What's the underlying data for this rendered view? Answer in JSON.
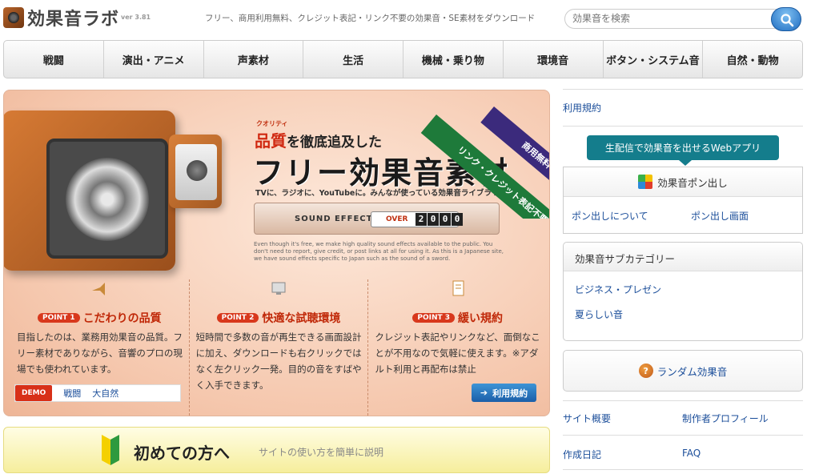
{
  "header": {
    "logo_text": "効果音ラボ",
    "version": "ver 3.81",
    "tagline": "フリー、商用利用無料、クレジット表記・リンク不要の効果音・SE素材をダウンロード",
    "search_placeholder": "効果音を検索"
  },
  "nav": [
    {
      "label": "戦闘"
    },
    {
      "label": "演出・アニメ"
    },
    {
      "label": "声素材"
    },
    {
      "label": "生活"
    },
    {
      "label": "機械・乗り物"
    },
    {
      "label": "環境音"
    },
    {
      "label": "ボタン・システム音"
    },
    {
      "label": "自然・動物"
    }
  ],
  "hero": {
    "ruby": "クオリティ",
    "headline_red": "品質",
    "headline_rest": "を徹底追及した",
    "headline_main": "フリー効果音素材",
    "subcopy": "TVに、ラジオに、YouTubeに。みんなが使っている効果音ライブラリ",
    "se_label": "SOUND EFFECTS",
    "over_label": "OVER",
    "counter_digits": [
      "2",
      "0",
      "0",
      "0"
    ],
    "english_copy": "Even though it's free, we make high quality sound effects available to the public. You don't need to report, give credit, or post links at all for using it. As this is a Japanese site, we have sound effects specific to Japan such as the sound of a sword.",
    "ribbon_green": "リンク・クレジット表記不要",
    "ribbon_purple": "商用無料",
    "points": [
      {
        "badge": "POINT 1",
        "title": "こだわりの品質",
        "body": "目指したのは、業務用効果音の品質。フリー素材でありながら、音響のプロの現場でも使われています。"
      },
      {
        "badge": "POINT 2",
        "title": "快適な試聴環境",
        "body": "短時間で多数の音が再生できる画面設計に加え、ダウンロードも右クリックではなく左クリック一発。目的の音をすばやく入手できます。"
      },
      {
        "badge": "POINT 3",
        "title": "緩い規約",
        "body": "クレジット表記やリンクなど、面倒なことが不用なので気軽に使えます。※アダルト利用と再配布は禁止"
      }
    ],
    "demo_tag": "DEMO",
    "demo_links": [
      "戦闘",
      "大自然"
    ],
    "terms_button": "利用規約"
  },
  "first_time": {
    "title": "初めての方へ",
    "subtitle": "サイトの使い方を簡単に説明"
  },
  "sidebar": {
    "terms_link": "利用規約",
    "webapp_button": "生配信で効果音を出せるWebアプリ",
    "pon_title": "効果音ポン出し",
    "pon_links": [
      "ポン出しについて",
      "ポン出し画面"
    ],
    "subcat_title": "効果音サブカテゴリー",
    "subcat_links": [
      "ビジネス・プレゼン",
      "夏らしい音"
    ],
    "random_button": "ランダム効果音",
    "footer_links": [
      "サイト概要",
      "制作者プロフィール",
      "作成日記",
      "FAQ"
    ]
  }
}
